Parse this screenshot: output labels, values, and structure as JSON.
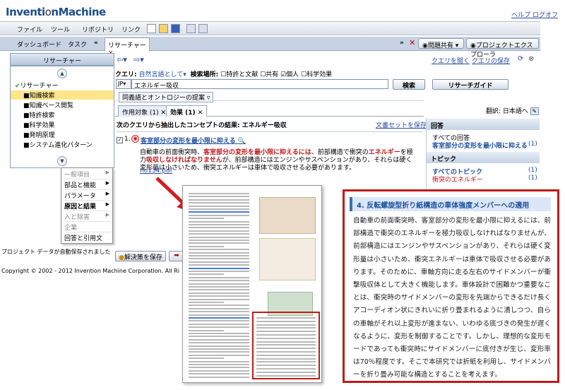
{
  "app": {
    "logo_bold": "Inventi",
    "logo_mark": "o",
    "logo_rest": "nMachine",
    "help": "ヘルプ",
    "logout": "ログオフ"
  },
  "menu": [
    "ファイル",
    "ツール",
    "リポジトリ",
    "リンク"
  ],
  "tabs": {
    "dashboard": "ダッシュボード",
    "task": "タスク",
    "research": "リサーチャー",
    "issue_share": "問題共有",
    "project_explorer": "プロジェクトエクスプローラ"
  },
  "left": {
    "header": "リサーチャー",
    "root": "リサーチャー",
    "items": [
      "■知識検索",
      "■知識ベース閲覧",
      "■特許検索",
      "■科学効果",
      "■発明原理",
      "■システム進化パターン"
    ]
  },
  "popup": {
    "items": [
      "一般項目",
      "部品と機能",
      "パラメータ",
      "原因と結果",
      "入と除害",
      "企業",
      "回答と引用文"
    ]
  },
  "nav": {
    "open_query": "クエリを開く",
    "save_query": "クエリの保存"
  },
  "query": {
    "label": "クエリ:",
    "mode": "自然言語として",
    "search_location": "検索場所:",
    "options": [
      "特許と文献",
      "共有",
      "個人",
      "科学効果"
    ],
    "lang": "JP",
    "value": "エネルギー吸収",
    "search_button": "検索",
    "guide_button": "リサーチガイド",
    "synonym": "同義語とオントロジーの提案"
  },
  "result_tabs": {
    "tab1": "作用対象 (1)",
    "tab2": "効果 (1)",
    "translate": "翻訳: 日本語へ"
  },
  "results": {
    "header": "次のクエリから抽出したコンセプトの結果: エネルギー吸収",
    "docset": "文書セットを保存...",
    "number": "1.",
    "title": "客室部分の変形を最小限に抑える",
    "snippet_a": "自動車の前面衝突時、",
    "snippet_b": "客室部分の変形を最小限に抑えるには",
    "snippet_c": "、前部構造で衝突の",
    "snippet_d": "エネルギー",
    "snippet_e": "を極力",
    "snippet_f": "吸収しなければなりません",
    "snippet_g": "が、前部構造にはエンジンやサスペンションがあり、それらは硬く変形量は小さいため、衝突エネルギーは車体で吸収させる必要があります。",
    "file": "no134.pdf"
  },
  "right": {
    "answers_head": "回答",
    "all_answers": "すべての回答",
    "answer_item": "客室部分の変形を最小限に抑える",
    "answer_count": "(1)",
    "topics_head": "トピック",
    "all_topics": "すべてのトピック",
    "topic_item": "衝突のエネルギー",
    "topic_count": "(1)"
  },
  "bottom": {
    "status": "プロジェクト データが自動保存されました",
    "solution_btn": "解決策を保存",
    "copyright": "Copyright © 2002 - 2012 Invention Machine Corporation. All Ri"
  },
  "callout": {
    "title": "4. 反転螺旋型折り紙構造の車体強度メンバーへの適用",
    "body": "自動車の前面衝突時、客室部分の変形を最小限に抑えるには、前部構造で衝突のエネルギーを極力吸収しなければなりませんが、前部構造にはエンジンやサスペンションがあり、それらは硬く変形量は小さいため、衝突エネルギーは車体で吸収させる必要があります。そのために、車軸方向に走る左右のサイドメンバーが衝撃吸収体として大きく機能します。車体設計で困難かつ重要なことは、衝突時のサイドメンバーの変形を先端からできるだけ長くアコーディオン状にきれいに折り畳まれるように潰しつつ、自らの車軸がそれ以上変形が進まない、いわゆる底づきの発生が遅くなるように、変形を制御することです。しかし、理想的な変形モードであっても衝突時にサイドメンバーに底付きが生じ、変形率は70％程度です。そこで本研究では折紙を利用し、サイドメンバーを折り畳み可能な構造とすることを考えます。"
  },
  "colors": {
    "accent": "#1f4fa0",
    "red": "#c0181c",
    "highlight": "#fde58a"
  }
}
